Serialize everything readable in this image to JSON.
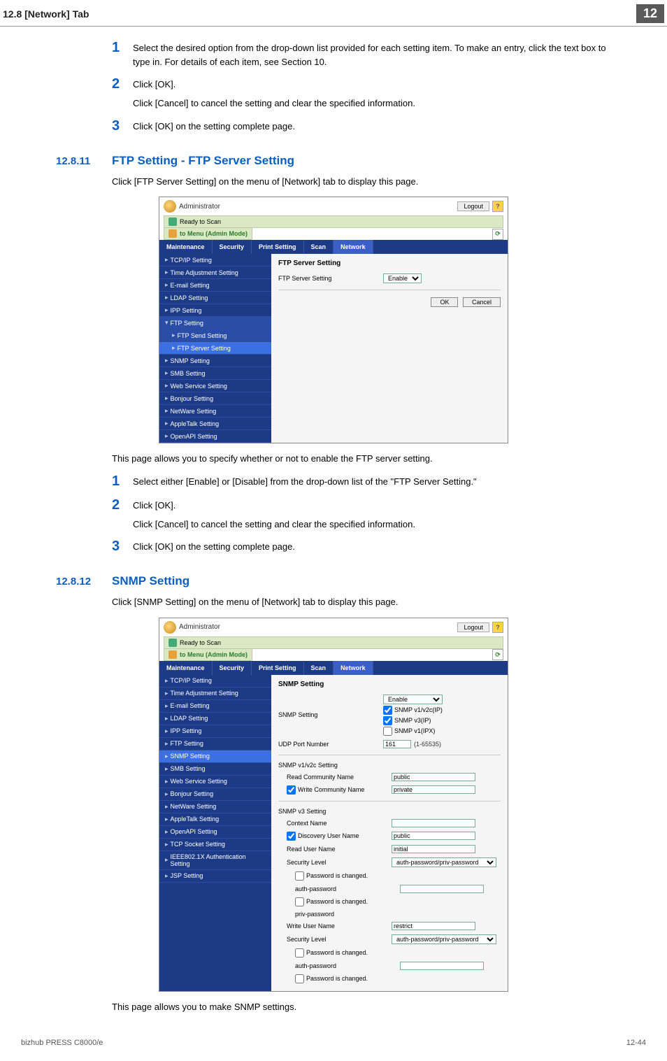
{
  "header": {
    "left": "12.8    [Network] Tab",
    "badge": "12"
  },
  "steps_a": {
    "s1": {
      "num": "1",
      "text": "Select the desired option from the drop-down list provided for each setting item. To make an entry, click the text box to type in. For details of each item, see Section 10."
    },
    "s2": {
      "num": "2",
      "text": "Click [OK].",
      "sub": "Click [Cancel] to cancel the setting and clear the specified information."
    },
    "s3": {
      "num": "3",
      "text": "Click [OK] on the setting complete page."
    }
  },
  "section_ftp": {
    "num": "12.8.11",
    "title": "FTP Setting - FTP Server Setting",
    "intro": "Click [FTP Server Setting] on the menu of [Network] tab to display this page.",
    "note": "This page allows you to specify whether or not to enable the FTP server setting."
  },
  "steps_b": {
    "s1": {
      "num": "1",
      "text": "Select either [Enable] or [Disable] from the drop-down list of the \"FTP Server Setting.\""
    },
    "s2": {
      "num": "2",
      "text": "Click [OK].",
      "sub": "Click [Cancel] to cancel the setting and clear the specified information."
    },
    "s3": {
      "num": "3",
      "text": "Click [OK] on the setting complete page."
    }
  },
  "section_snmp": {
    "num": "12.8.12",
    "title": "SNMP Setting",
    "intro": "Click [SNMP Setting] on the menu of [Network] tab to display this page.",
    "note": "This page allows you to make SNMP settings."
  },
  "ss": {
    "admin": "Administrator",
    "logout": "Logout",
    "help": "?",
    "ready": "Ready to Scan",
    "mode": "to Menu (Admin Mode)",
    "refresh": "⟳",
    "tabs": [
      "Maintenance",
      "Security",
      "Print Setting",
      "Scan",
      "Network"
    ],
    "side_common": {
      "tcpip": "TCP/IP Setting",
      "time": "Time Adjustment Setting",
      "email": "E-mail Setting",
      "ldap": "LDAP Setting",
      "ipp": "IPP Setting",
      "ftp": "FTP Setting",
      "ftp_send": "FTP Send Setting",
      "ftp_server": "FTP Server Setting",
      "snmp": "SNMP Setting",
      "smb": "SMB Setting",
      "ws": "Web Service Setting",
      "bonjour": "Bonjour Setting",
      "netware": "NetWare Setting",
      "appletalk": "AppleTalk Setting",
      "openapi": "OpenAPI Setting",
      "tcpsock": "TCP Socket Setting",
      "ieee": "IEEE802.1X Authentication Setting",
      "jsp": "JSP Setting"
    },
    "ftp_main": {
      "heading": "FTP Server Setting",
      "row_label": "FTP Server Setting",
      "select_val": "Enable",
      "ok": "OK",
      "cancel": "Cancel"
    },
    "snmp_main": {
      "heading": "SNMP Setting",
      "snmp_setting_label": "SNMP Setting",
      "snmp_setting_val": "Enable",
      "cb1": "SNMP v1/v2c(IP)",
      "cb2": "SNMP v3(IP)",
      "cb3": "SNMP v1(IPX)",
      "udp_label": "UDP Port Number",
      "udp_val": "161",
      "udp_range": "(1-65535)",
      "v1v2_heading": "SNMP v1/v2c Setting",
      "read_comm_lbl": "Read Community Name",
      "read_comm_val": "public",
      "write_comm_lbl": "Write Community Name",
      "write_comm_val": "private",
      "v3_heading": "SNMP v3 Setting",
      "context_lbl": "Context Name",
      "disc_user_lbl": "Discovery User Name",
      "disc_user_val": "public",
      "read_user_lbl": "Read User Name",
      "read_user_val": "initial",
      "sec_lvl_lbl": "Security Level",
      "sec_lvl_val": "auth-password/priv-password",
      "pw_changed": "Password is changed.",
      "auth_pw_lbl": "auth-password",
      "priv_pw_lbl": "priv-password",
      "write_user_lbl": "Write User Name",
      "write_user_val": "restrict"
    }
  },
  "footer": {
    "left": "bizhub PRESS C8000/e",
    "right": "12-44"
  }
}
